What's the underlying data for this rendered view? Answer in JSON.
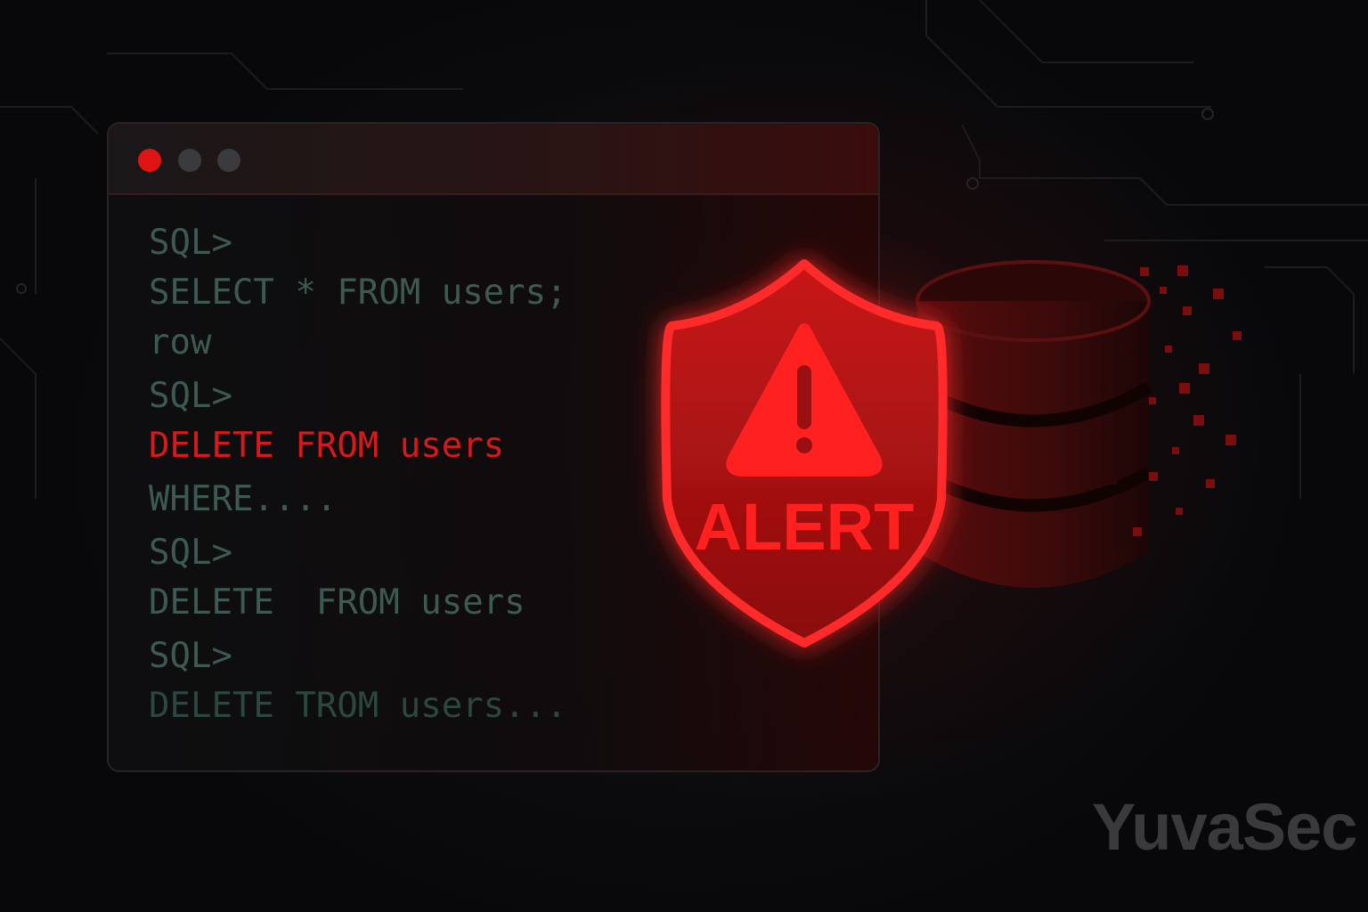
{
  "terminal": {
    "window_controls": [
      "close",
      "minimize",
      "maximize"
    ],
    "lines": [
      {
        "text": "SQL>",
        "style": "normal"
      },
      {
        "text": "SELECT * FROM users;",
        "style": "normal"
      },
      {
        "text": "row",
        "style": "normal"
      },
      {
        "text": "SQL>",
        "style": "normal"
      },
      {
        "text": "DELETE FROM users",
        "style": "danger"
      },
      {
        "text": "WHERE....",
        "style": "normal"
      },
      {
        "text": "SQL>",
        "style": "normal"
      },
      {
        "text": "DELETE  FROM users",
        "style": "normal"
      },
      {
        "text": "SQL>",
        "style": "normal"
      },
      {
        "text": "DELETE TROM users...",
        "style": "faded"
      }
    ]
  },
  "alert": {
    "label": "ALERT",
    "icon": "warning-triangle-icon"
  },
  "database": {
    "icon": "database-icon"
  },
  "brand": {
    "name": "YuvaSec"
  },
  "colors": {
    "alert_red": "#e81c1c",
    "code_green": "#3d5a52",
    "background": "#0a0a0b"
  }
}
